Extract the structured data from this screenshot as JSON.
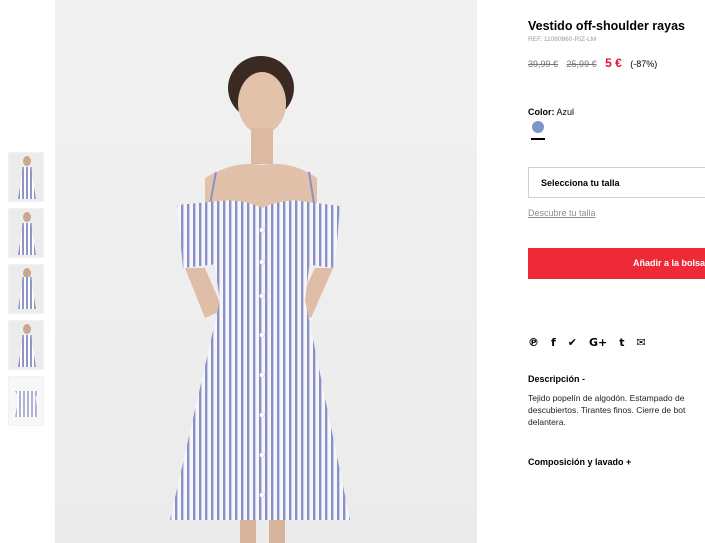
{
  "product": {
    "title": "Vestido off-shoulder rayas",
    "ref": "REF. 11080860-RIZ-LM",
    "price_old_1": "39,99 €",
    "price_old_2": "25,99 €",
    "price_new": "5 €",
    "discount": "(-87%)"
  },
  "color": {
    "label": "Color:",
    "value": "Azul",
    "swatch_hex": "#7d96c8"
  },
  "size": {
    "select_label": "Selecciona tu talla",
    "guide_link": "Descubre tu talla"
  },
  "cart": {
    "add_label": "Añadir a la bolsa",
    "accent": "#ee2a38"
  },
  "share": {
    "icons": [
      "pinterest-icon",
      "facebook-icon",
      "twitter-icon",
      "google-plus-icon",
      "tumblr-icon",
      "email-icon"
    ],
    "glyphs": [
      "℗",
      "f",
      "✔",
      "G+",
      "t",
      "✉"
    ]
  },
  "description": {
    "heading": "Descripción -",
    "lines": [
      "Tejido popelín de algodón. Estampado de",
      "descubiertos. Tirantes finos. Cierre de bot",
      "delantera."
    ]
  },
  "composition": {
    "heading": "Composición y lavado +"
  },
  "thumbnails": [
    "front",
    "full",
    "back",
    "detail",
    "flat"
  ]
}
